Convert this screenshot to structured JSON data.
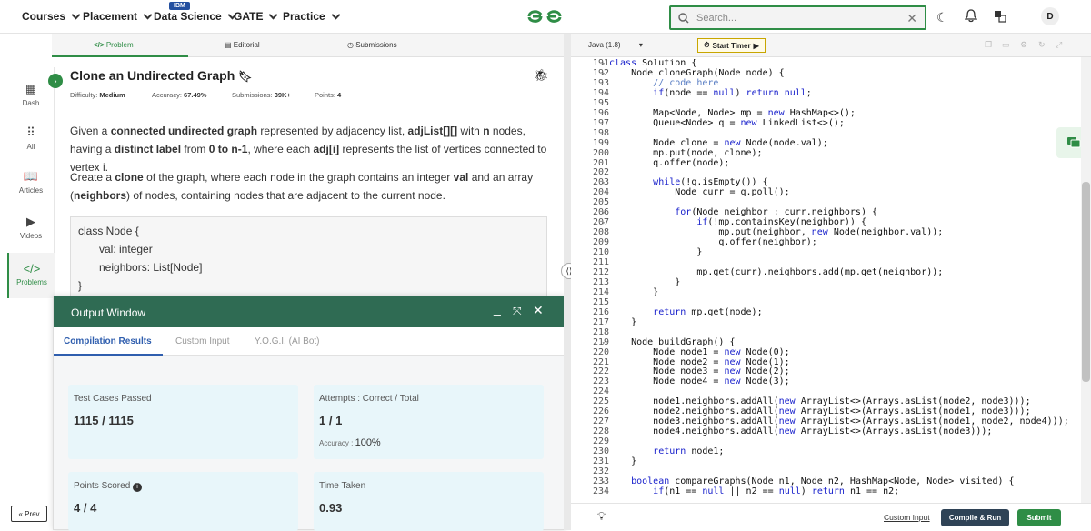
{
  "nav": {
    "items": [
      "Courses",
      "Placement",
      "Data Science",
      "GATE",
      "Practice"
    ],
    "ibm_badge": "IBM",
    "search_placeholder": "Search...",
    "avatar": "D"
  },
  "rail": {
    "items": [
      {
        "label": "Dash",
        "icon": "dashboard-icon"
      },
      {
        "label": "All",
        "icon": "grid-icon"
      },
      {
        "label": "Articles",
        "icon": "book-icon"
      },
      {
        "label": "Videos",
        "icon": "video-icon"
      },
      {
        "label": "Problems",
        "icon": "code-icon"
      }
    ],
    "prev": "« Prev"
  },
  "tabs": {
    "problem": "Problem",
    "editorial": "Editorial",
    "submissions": "Submissions"
  },
  "problem": {
    "title": "Clone an Undirected Graph",
    "difficulty_label": "Difficulty:",
    "difficulty": "Medium",
    "accuracy_label": "Accuracy:",
    "accuracy": "67.49%",
    "submissions_label": "Submissions:",
    "submissions": "39K+",
    "points_label": "Points:",
    "points": "4",
    "desc1_a": "Given a",
    "desc1_b": "connected undirected graph",
    "desc1_c": "represented by adjacency list,",
    "desc1_d": "adjList[][]",
    "desc1_e": "with",
    "desc1_f": "n",
    "desc1_g": "nodes, having a",
    "desc1_h": "distinct label",
    "desc1_i": "from",
    "desc1_j": "0 to n-1",
    "desc1_k": ", where each",
    "desc1_l": "adj[i]",
    "desc1_m": "represents the list of vertices connected to vertex i.",
    "desc2_a": "Create a",
    "desc2_b": "clone",
    "desc2_c": "of the graph, where each node in the graph contains an integer",
    "desc2_d": "val",
    "desc2_e": "and an array",
    "desc2_f": "(",
    "desc2_g": "neighbors",
    "desc2_h": ") of nodes, containing nodes that are adjacent to the current node.",
    "code_lines": [
      "class  Node  {",
      "val:  integer",
      "neighbors:  List[Node]",
      "}"
    ]
  },
  "output": {
    "title": "Output Window",
    "tabs": [
      "Compilation Results",
      "Custom Input",
      "Y.O.G.I. (AI Bot)"
    ],
    "cards": {
      "tests_label": "Test Cases Passed",
      "tests_value": "1115 / 1115",
      "attempts_label": "Attempts : Correct / Total",
      "attempts_value": "1 / 1",
      "accuracy_label": "Accuracy :",
      "accuracy_value": "100%",
      "points_label": "Points Scored",
      "points_value": "4 / 4",
      "time_label": "Time Taken",
      "time_value": "0.93"
    }
  },
  "editor": {
    "language": "Java (1.8)",
    "timer": "Start Timer",
    "custom_input": "Custom Input",
    "compile_run": "Compile & Run",
    "submit": "Submit",
    "lines": [
      {
        "n": "191",
        "t": "class Solution {"
      },
      {
        "n": "192",
        "t": "    Node cloneGraph(Node node) {"
      },
      {
        "n": "193",
        "t": "        // code here"
      },
      {
        "n": "194",
        "t": "        if(node == null) return null;"
      },
      {
        "n": "195",
        "t": ""
      },
      {
        "n": "196",
        "t": "        Map<Node, Node> mp = new HashMap<>();"
      },
      {
        "n": "197",
        "t": "        Queue<Node> q = new LinkedList<>();"
      },
      {
        "n": "198",
        "t": ""
      },
      {
        "n": "199",
        "t": "        Node clone = new Node(node.val);"
      },
      {
        "n": "200",
        "t": "        mp.put(node, clone);"
      },
      {
        "n": "201",
        "t": "        q.offer(node);"
      },
      {
        "n": "202",
        "t": ""
      },
      {
        "n": "203",
        "t": "        while(!q.isEmpty()) {"
      },
      {
        "n": "204",
        "t": "            Node curr = q.poll();"
      },
      {
        "n": "205",
        "t": ""
      },
      {
        "n": "206",
        "t": "            for(Node neighbor : curr.neighbors) {"
      },
      {
        "n": "207",
        "t": "                if(!mp.containsKey(neighbor)) {"
      },
      {
        "n": "208",
        "t": "                    mp.put(neighbor, new Node(neighbor.val));"
      },
      {
        "n": "209",
        "t": "                    q.offer(neighbor);"
      },
      {
        "n": "210",
        "t": "                }"
      },
      {
        "n": "211",
        "t": ""
      },
      {
        "n": "212",
        "t": "                mp.get(curr).neighbors.add(mp.get(neighbor));"
      },
      {
        "n": "213",
        "t": "            }"
      },
      {
        "n": "214",
        "t": "        }"
      },
      {
        "n": "215",
        "t": ""
      },
      {
        "n": "216",
        "t": "        return mp.get(node);"
      },
      {
        "n": "217",
        "t": "    }"
      },
      {
        "n": "218",
        "t": ""
      },
      {
        "n": "219",
        "t": "    Node buildGraph() {"
      },
      {
        "n": "220",
        "t": "        Node node1 = new Node(0);"
      },
      {
        "n": "221",
        "t": "        Node node2 = new Node(1);"
      },
      {
        "n": "222",
        "t": "        Node node3 = new Node(2);"
      },
      {
        "n": "223",
        "t": "        Node node4 = new Node(3);"
      },
      {
        "n": "224",
        "t": ""
      },
      {
        "n": "225",
        "t": "        node1.neighbors.addAll(new ArrayList<>(Arrays.asList(node2, node3)));"
      },
      {
        "n": "226",
        "t": "        node2.neighbors.addAll(new ArrayList<>(Arrays.asList(node1, node3)));"
      },
      {
        "n": "227",
        "t": "        node3.neighbors.addAll(new ArrayList<>(Arrays.asList(node1, node2, node4)));"
      },
      {
        "n": "228",
        "t": "        node4.neighbors.addAll(new ArrayList<>(Arrays.asList(node3)));"
      },
      {
        "n": "229",
        "t": ""
      },
      {
        "n": "230",
        "t": "        return node1;"
      },
      {
        "n": "231",
        "t": "    }"
      },
      {
        "n": "232",
        "t": ""
      },
      {
        "n": "233",
        "t": "    boolean compareGraphs(Node n1, Node n2, HashMap<Node, Node> visited) {"
      },
      {
        "n": "234",
        "t": "        if(n1 == null || n2 == null) return n1 == n2;"
      }
    ]
  },
  "colors": {
    "brand_green": "#2f8d46",
    "output_header": "#2f6b53",
    "keyword_blue": "#1a22cc"
  }
}
